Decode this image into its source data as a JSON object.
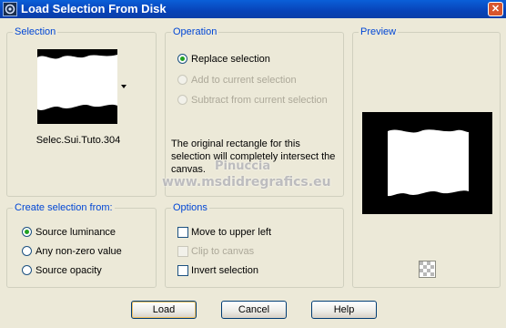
{
  "window": {
    "title": "Load Selection From Disk",
    "close_glyph": "✕"
  },
  "selection_group": {
    "label": "Selection",
    "thumbnail_name": "Selec.Sui.Tuto.304"
  },
  "operation_group": {
    "label": "Operation",
    "options": [
      {
        "label": "Replace selection",
        "selected": true,
        "enabled": true
      },
      {
        "label": "Add to current selection",
        "selected": false,
        "enabled": false
      },
      {
        "label": "Subtract from current selection",
        "selected": false,
        "enabled": false
      }
    ],
    "note": "The original rectangle for this selection will completely intersect the canvas."
  },
  "preview_group": {
    "label": "Preview"
  },
  "create_group": {
    "label": "Create selection from:",
    "options": [
      {
        "label": "Source luminance",
        "selected": true
      },
      {
        "label": "Any non-zero value",
        "selected": false
      },
      {
        "label": "Source opacity",
        "selected": false
      }
    ]
  },
  "options_group": {
    "label": "Options",
    "items": [
      {
        "label": "Move to upper left",
        "checked": false,
        "enabled": true
      },
      {
        "label": "Clip to canvas",
        "checked": false,
        "enabled": false
      },
      {
        "label": "Invert selection",
        "checked": false,
        "enabled": true
      }
    ]
  },
  "watermark": {
    "line1": "Pinuccia",
    "line2": "www.msdidregrafics.eu"
  },
  "buttons": {
    "load": "Load",
    "cancel": "Cancel",
    "help": "Help"
  },
  "colors": {
    "title_bar": "#0a5fd8",
    "group_label": "#0046d5",
    "radio_dot": "#21a121",
    "disabled_text": "#aca899"
  }
}
